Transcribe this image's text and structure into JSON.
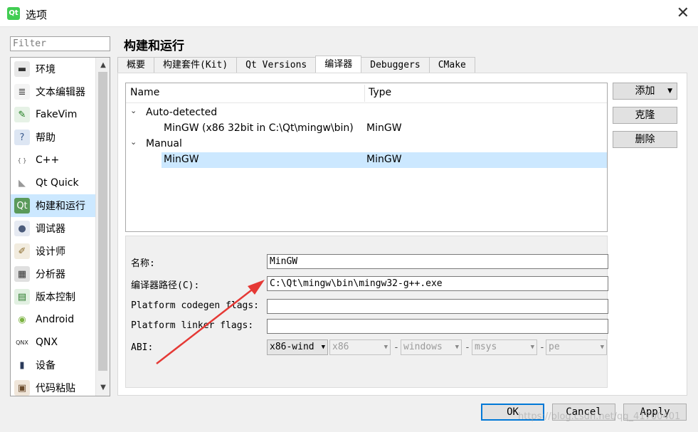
{
  "window": {
    "title": "选项",
    "icon_text": "Qt",
    "close_glyph": "✕"
  },
  "filter": {
    "placeholder": "Filter"
  },
  "sidebar": {
    "items": [
      {
        "label": "环境",
        "icon": "monitor-icon",
        "glyph": "▬",
        "color": "#333333",
        "bg": "#e8e8e8"
      },
      {
        "label": "文本编辑器",
        "icon": "text-editor-icon",
        "glyph": "≣",
        "color": "#444444",
        "bg": "#f4f4f4"
      },
      {
        "label": "FakeVim",
        "icon": "fakevim-icon",
        "glyph": "✎",
        "color": "#1a7a1a",
        "bg": "#e6f2e6"
      },
      {
        "label": "帮助",
        "icon": "help-icon",
        "glyph": "?",
        "color": "#3a5a8c",
        "bg": "#dde6f3"
      },
      {
        "label": "C++",
        "icon": "cpp-braces-icon",
        "glyph": "{ }",
        "color": "#555555",
        "bg": "#ffffff"
      },
      {
        "label": "Qt Quick",
        "icon": "qt-quick-icon",
        "glyph": "◣",
        "color": "#999999",
        "bg": "#ffffff"
      },
      {
        "label": "构建和运行",
        "icon": "build-run-icon",
        "glyph": "Qt",
        "color": "#ffffff",
        "bg": "#5a9a5a"
      },
      {
        "label": "调试器",
        "icon": "debugger-icon",
        "glyph": "●",
        "color": "#4a5a7a",
        "bg": "#e6eaf2"
      },
      {
        "label": "设计师",
        "icon": "designer-icon",
        "glyph": "✐",
        "color": "#8a6a2a",
        "bg": "#f2ecdf"
      },
      {
        "label": "分析器",
        "icon": "analyzer-icon",
        "glyph": "▦",
        "color": "#333333",
        "bg": "#e0e0e0"
      },
      {
        "label": "版本控制",
        "icon": "version-control-icon",
        "glyph": "▤",
        "color": "#2a7a2a",
        "bg": "#e2f0e2"
      },
      {
        "label": "Android",
        "icon": "android-icon",
        "glyph": "◉",
        "color": "#7cb342",
        "bg": "#ffffff"
      },
      {
        "label": "QNX",
        "icon": "qnx-icon",
        "glyph": "QNX",
        "color": "#222222",
        "bg": "#ffffff"
      },
      {
        "label": "设备",
        "icon": "device-icon",
        "glyph": "▮",
        "color": "#2a3a5a",
        "bg": "#ffffff"
      },
      {
        "label": "代码粘贴",
        "icon": "code-paste-icon",
        "glyph": "▣",
        "color": "#6a4a2a",
        "bg": "#f0e6da"
      }
    ],
    "selected_index": 6
  },
  "page": {
    "title": "构建和运行"
  },
  "tabs": [
    {
      "label": "概要"
    },
    {
      "label": "构建套件(Kit)"
    },
    {
      "label": "Qt Versions"
    },
    {
      "label": "编译器",
      "active": true
    },
    {
      "label": "Debuggers"
    },
    {
      "label": "CMake"
    }
  ],
  "compiler_tree": {
    "headers": {
      "name": "Name",
      "type": "Type"
    },
    "groups": [
      {
        "label": "Auto-detected",
        "expanded": true,
        "rows": [
          {
            "name": "MinGW (x86 32bit in C:\\Qt\\mingw\\bin)",
            "type": "MinGW"
          }
        ]
      },
      {
        "label": "Manual",
        "expanded": true,
        "rows": [
          {
            "name": "MinGW",
            "type": "MinGW",
            "selected": true
          }
        ]
      }
    ]
  },
  "buttons": {
    "add": "添加",
    "clone": "克隆",
    "remove": "删除"
  },
  "details": {
    "name_label": "名称:",
    "name_value": "MinGW",
    "path_label": "编译器路径(C):",
    "path_value": "C:\\Qt\\mingw\\bin\\mingw32-g++.exe",
    "codegen_label": "Platform codegen flags:",
    "codegen_value": "",
    "linker_label": "Platform linker flags:",
    "linker_value": "",
    "abi_label": "ABI:",
    "abi": {
      "main": "x86-wind",
      "arch": "x86",
      "os": "windows",
      "flavor": "msys",
      "format": "pe"
    }
  },
  "dialog_buttons": {
    "ok": "OK",
    "cancel": "Cancel",
    "apply": "Apply"
  },
  "watermark": "https://blog.csdn.net/qq_41700401",
  "colors": {
    "selection": "#cce8ff",
    "default_button_border": "#0078d7",
    "annotation_arrow": "#e53935"
  }
}
